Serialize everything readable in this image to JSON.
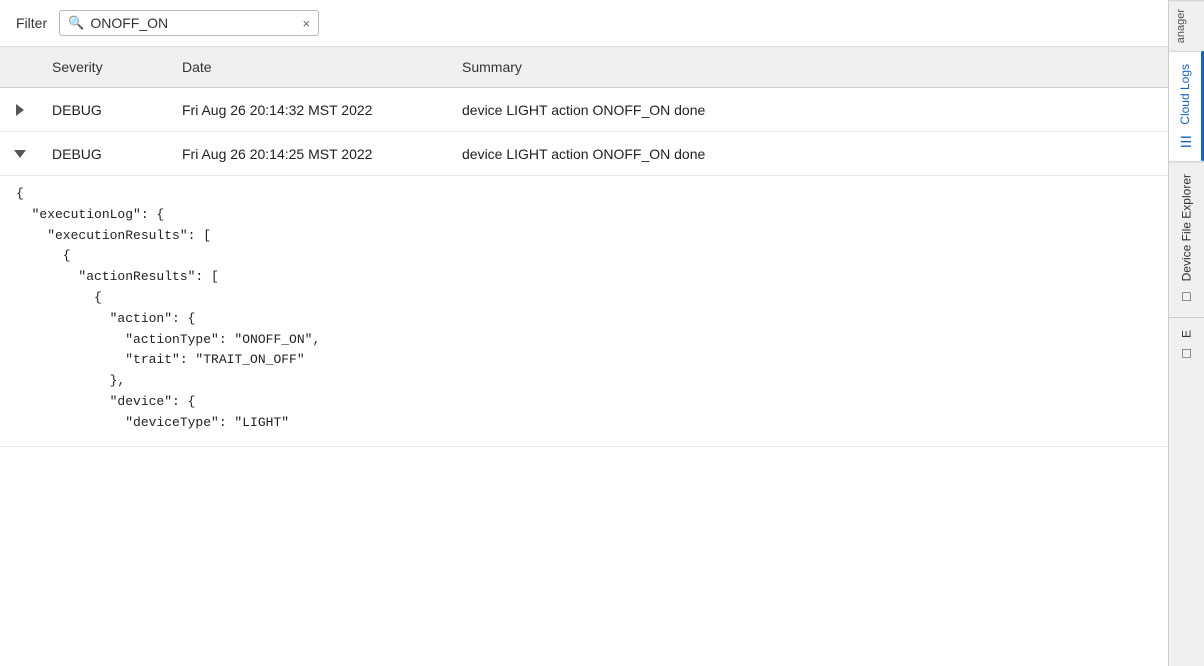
{
  "filter": {
    "label": "Filter",
    "value": "ONOFF_ON",
    "icon": "🔍",
    "clear_label": "×"
  },
  "table": {
    "headers": {
      "expand": "",
      "severity": "Severity",
      "date": "Date",
      "summary": "Summary"
    },
    "rows": [
      {
        "id": "row-1",
        "expanded": false,
        "toggle_symbol": "▶",
        "severity": "DEBUG",
        "date": "Fri Aug 26 20:14:32 MST 2022",
        "summary": "device LIGHT action ONOFF_ON done"
      },
      {
        "id": "row-2",
        "expanded": true,
        "toggle_symbol": "▼",
        "severity": "DEBUG",
        "date": "Fri Aug 26 20:14:25 MST 2022",
        "summary": "device LIGHT action ONOFF_ON done"
      }
    ],
    "expanded_json": "{\n  \"executionLog\": {\n    \"executionResults\": [\n      {\n        \"actionResults\": [\n          {\n            \"action\": {\n              \"actionType\": \"ONOFF_ON\",\n              \"trait\": \"TRAIT_ON_OFF\"\n            },\n            \"device\": {\n              \"deviceType\": \"LIGHT\""
  },
  "sidebar": {
    "manager_label": "anager",
    "tabs": [
      {
        "id": "cloud-logs",
        "label": "Cloud Logs",
        "icon": "☰",
        "active": true
      },
      {
        "id": "device-file-explorer",
        "label": "Device File Explorer",
        "icon": "□",
        "active": false
      },
      {
        "id": "tab3",
        "label": "E",
        "icon": "□",
        "active": false
      }
    ]
  }
}
